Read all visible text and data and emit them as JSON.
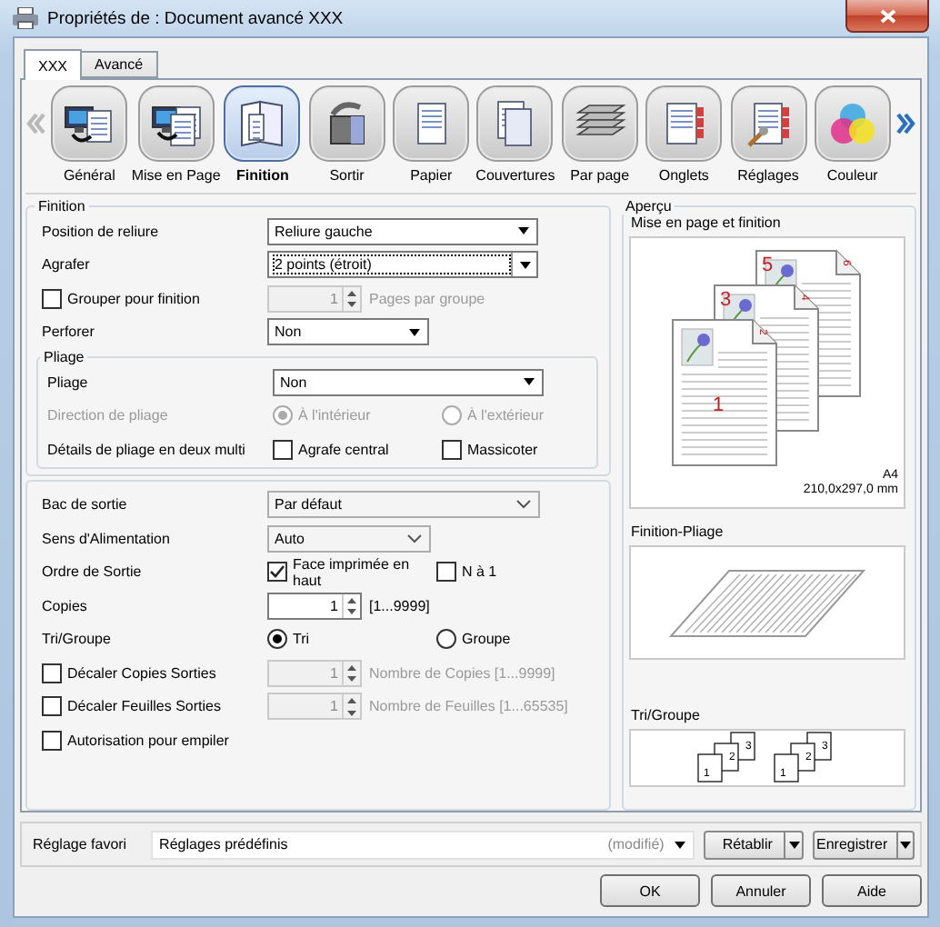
{
  "window": {
    "title": "Propriétés de : Document avancé XXX"
  },
  "tabs": [
    {
      "label": "XXX",
      "selected": true
    },
    {
      "label": "Avancé",
      "selected": false
    }
  ],
  "carousel": {
    "back_enabled": false,
    "forward_enabled": true
  },
  "categories": [
    {
      "label": "Général",
      "kind": "general",
      "selected": false
    },
    {
      "label": "Mise en Page",
      "kind": "layout",
      "selected": false
    },
    {
      "label": "Finition",
      "kind": "finishing",
      "selected": true
    },
    {
      "label": "Sortir",
      "kind": "output",
      "selected": false
    },
    {
      "label": "Papier",
      "kind": "paper",
      "selected": false
    },
    {
      "label": "Couvertures",
      "kind": "covers",
      "selected": false
    },
    {
      "label": "Par page",
      "kind": "perpage",
      "selected": false
    },
    {
      "label": "Onglets",
      "kind": "tabs",
      "selected": false
    },
    {
      "label": "Réglages",
      "kind": "settings",
      "selected": false
    },
    {
      "label": "Couleur",
      "kind": "color",
      "selected": false
    }
  ],
  "finishing": {
    "title": "Finition",
    "rows": [
      {
        "kind": "select",
        "label": "Position de reliure",
        "value": "Reliure gauche",
        "compact": false,
        "focused": false
      },
      {
        "kind": "select",
        "label": "Agrafer",
        "value": "2 points (étroit)",
        "compact": false,
        "focused": true
      },
      {
        "kind": "checkspin",
        "checkbox": {
          "label": "Grouper pour finition",
          "checked": false
        },
        "spin": {
          "value": "1",
          "disabled": true,
          "note": "Pages par groupe"
        }
      },
      {
        "kind": "select",
        "label": "Perforer",
        "value": "Non",
        "compact": true,
        "focused": false
      }
    ],
    "folding": {
      "title": "Pliage",
      "rows": [
        {
          "kind": "select",
          "label": "Pliage",
          "value": "Non",
          "compact": false,
          "focused": false
        },
        {
          "kind": "radios",
          "label": "Direction de pliage",
          "disabled": true,
          "options": [
            {
              "label": "À l'intérieur",
              "selected": true
            },
            {
              "label": "À l'extérieur",
              "selected": false
            }
          ]
        },
        {
          "kind": "checks",
          "label": "Détails de pliage en deux multi",
          "options": [
            {
              "label": "Agrafe central",
              "checked": false
            },
            {
              "label": "Massicoter",
              "checked": false
            }
          ]
        }
      ]
    }
  },
  "output": {
    "rows": [
      {
        "kind": "combo",
        "label": "Bac de sortie",
        "value": "Par défaut",
        "compact": false
      },
      {
        "kind": "combo",
        "label": "Sens d'Alimentation",
        "value": "Auto",
        "compact": true
      },
      {
        "kind": "checks",
        "label": "Ordre de Sortie",
        "options": [
          {
            "label": "Face imprimée en haut",
            "checked": true
          },
          {
            "label": "N à 1",
            "checked": false
          }
        ]
      },
      {
        "kind": "spin",
        "label": "Copies",
        "spin": {
          "value": "1",
          "disabled": false,
          "note": "[1...9999]"
        }
      },
      {
        "kind": "radios",
        "label": "Tri/Groupe",
        "disabled": false,
        "options": [
          {
            "label": "Tri",
            "selected": true
          },
          {
            "label": "Groupe",
            "selected": false
          }
        ]
      },
      {
        "kind": "checkspin",
        "checkbox": {
          "label": "Décaler Copies Sorties",
          "checked": false
        },
        "spin": {
          "value": "1",
          "disabled": true,
          "note": "Nombre de Copies [1...9999]"
        }
      },
      {
        "kind": "checkspin",
        "checkbox": {
          "label": "Décaler Feuilles Sorties",
          "checked": false
        },
        "spin": {
          "value": "1",
          "disabled": true,
          "note": "Nombre de Feuilles [1...65535]"
        }
      },
      {
        "kind": "check",
        "checkbox": {
          "label": "Autorisation pour empiler",
          "checked": false
        }
      }
    ]
  },
  "preview": {
    "title": "Aperçu",
    "layout_label": "Mise en page et finition",
    "pages": [
      {
        "front": "1",
        "back": "2"
      },
      {
        "front": "3",
        "back": "4"
      },
      {
        "front": "5",
        "back": "6"
      }
    ],
    "paper": "A4",
    "dimensions": "210,0x297,0 mm",
    "fold_label": "Finition-Pliage",
    "sort_label": "Tri/Groupe",
    "sort_stacks": [
      [
        "1",
        "2",
        "3"
      ],
      [
        "1",
        "2",
        "3"
      ]
    ]
  },
  "favorite": {
    "label": "Réglage favori",
    "value": "Réglages prédéfinis",
    "status": "(modifié)",
    "buttons": [
      "Rétablir",
      "Enregistrer"
    ]
  },
  "buttons": [
    "OK",
    "Annuler",
    "Aide"
  ]
}
